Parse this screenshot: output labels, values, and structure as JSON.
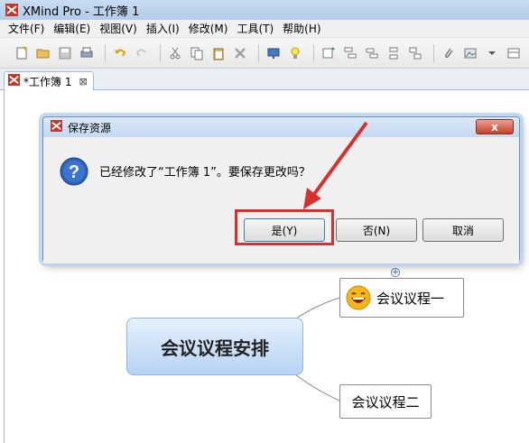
{
  "window": {
    "title": "XMind Pro - 工作簿 1"
  },
  "menu": [
    "文件(F)",
    "编辑(E)",
    "视图(V)",
    "插入(I)",
    "修改(M)",
    "工具(T)",
    "帮助(H)"
  ],
  "tab": {
    "label": "*工作簿 1",
    "close": "⊠"
  },
  "dialog": {
    "title": "保存资源",
    "close": "x",
    "message": "已经修改了“工作簿 1”。要保存更改吗？",
    "buttons": {
      "yes": "是(Y)",
      "no": "否(N)",
      "cancel": "取消"
    }
  },
  "canvas": {
    "central_topic": "会议议程安排",
    "subtopics": [
      "会议议程一",
      "会议议程二"
    ],
    "expand_symbol": "+"
  },
  "colors": {
    "highlight": "#d5312f",
    "close_button": "#c7412a",
    "central_fill": "#b6d3f3"
  }
}
